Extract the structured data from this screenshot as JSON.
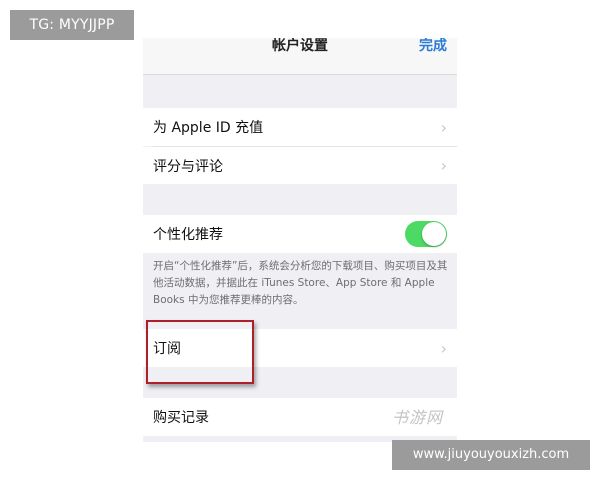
{
  "watermark_top_left": "TG: MYYJJPP",
  "watermark_bottom_right": "www.jiuyouyouxizh.com",
  "watermark_logo_text": "书游网",
  "navbar": {
    "title": "帐户设置",
    "done_label": "完成"
  },
  "rows": {
    "topup": "为 Apple ID 充值",
    "ratings": "评分与评论",
    "personalized": "个性化推荐",
    "subscriptions": "订阅",
    "purchase_history": "购买记录"
  },
  "toggle": {
    "personalized_on": true,
    "color": "#4cd964"
  },
  "footer_text": "开启“个性化推荐”后，系统会分析您的下载项目、购买项目及其他活动数据，并据此在 iTunes Store、App Store 和 Apple Books 中为您推荐更棒的内容。",
  "colors": {
    "link": "#2a7ad6",
    "highlight_box": "#b01e2a",
    "group_background": "#efeff4"
  },
  "icons": {
    "chevron": "›"
  }
}
